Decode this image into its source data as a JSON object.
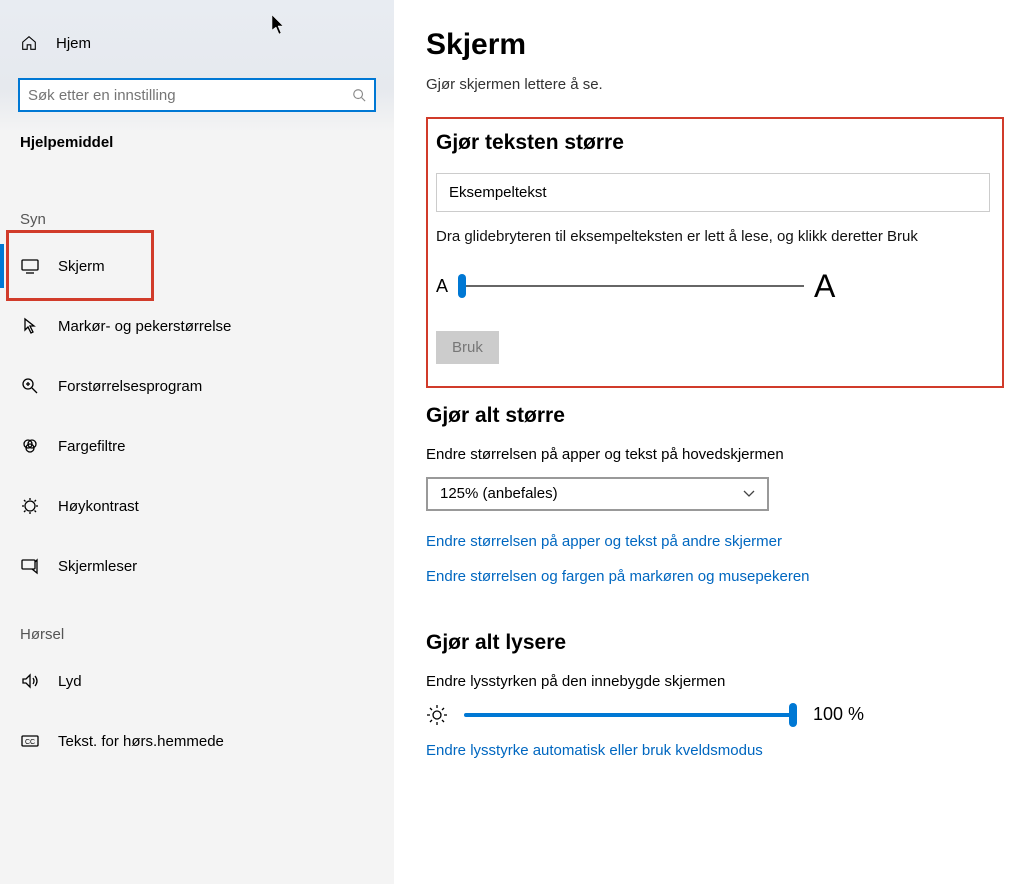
{
  "sidebar": {
    "home_label": "Hjem",
    "search_placeholder": "Søk etter en innstilling",
    "section_title": "Hjelpemiddel",
    "categories": {
      "syn": "Syn",
      "horsel": "Hørsel"
    },
    "items": {
      "skjerm": "Skjerm",
      "markor": "Markør- og pekerstørrelse",
      "forstorrelse": "Forstørrelsesprogram",
      "fargefiltre": "Fargefiltre",
      "hoykontrast": "Høykontrast",
      "skjermleser": "Skjermleser",
      "lyd": "Lyd",
      "tekst_hors": "Tekst. for hørs.hemmede"
    }
  },
  "main": {
    "title": "Skjerm",
    "subtitle": "Gjør skjermen lettere å se.",
    "text_bigger": {
      "heading": "Gjør teksten større",
      "sample": "Eksempeltekst",
      "hint": "Dra glidebryteren til eksempelteksten er lett å lese, og klikk deretter Bruk",
      "small_a": "A",
      "big_a": "A",
      "apply": "Bruk"
    },
    "all_bigger": {
      "heading": "Gjør alt større",
      "desc": "Endre størrelsen på apper og tekst på hovedskjermen",
      "select_value": "125% (anbefales)",
      "link_other": "Endre størrelsen på apper og tekst på andre skjermer",
      "link_cursor": "Endre størrelsen og fargen på markøren og musepekeren"
    },
    "brighter": {
      "heading": "Gjør alt lysere",
      "desc": "Endre lysstyrken på den innebygde skjermen",
      "value": "100 %",
      "link": "Endre lysstyrke automatisk eller bruk kveldsmodus"
    }
  }
}
